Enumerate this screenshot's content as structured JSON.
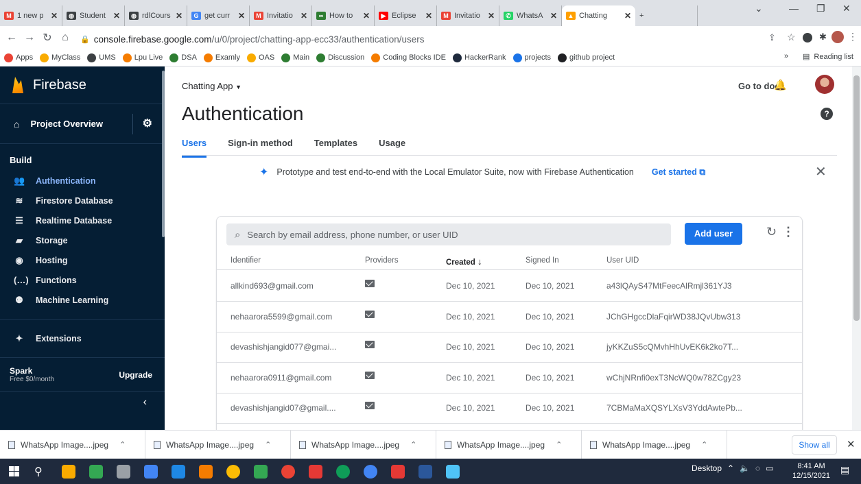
{
  "browser": {
    "tabs": [
      {
        "label": "1 new p",
        "color": "#ea4335",
        "glyph": "M"
      },
      {
        "label": "Student",
        "color": "#3c4043",
        "glyph": "◍"
      },
      {
        "label": "rdlCours",
        "color": "#3c4043",
        "glyph": "◍"
      },
      {
        "label": "get curr",
        "color": "#4285f4",
        "glyph": "G"
      },
      {
        "label": "Invitatio",
        "color": "#ea4335",
        "glyph": "M"
      },
      {
        "label": "How to",
        "color": "#2e7d32",
        "glyph": "∞"
      },
      {
        "label": "Eclipse",
        "color": "#ff0000",
        "glyph": "▶"
      },
      {
        "label": "Invitatio",
        "color": "#ea4335",
        "glyph": "M"
      },
      {
        "label": "WhatsA",
        "color": "#25d366",
        "glyph": "✆"
      },
      {
        "label": "Chatting",
        "color": "#ffa000",
        "glyph": "▲",
        "active": true
      }
    ],
    "url_host": "console.firebase.google.com",
    "url_path": "/u/0/project/chatting-app-ecc33/authentication/users",
    "bookmarks": [
      {
        "label": "Apps",
        "color": "#ea4335"
      },
      {
        "label": "MyClass",
        "color": "#f9ab00"
      },
      {
        "label": "UMS",
        "color": "#3c4043"
      },
      {
        "label": "Lpu Live",
        "color": "#f57c00"
      },
      {
        "label": "DSA",
        "color": "#2e7d32"
      },
      {
        "label": "Examly",
        "color": "#f57c00"
      },
      {
        "label": "OAS",
        "color": "#f9ab00"
      },
      {
        "label": "Main",
        "color": "#2e7d32"
      },
      {
        "label": "Discussion",
        "color": "#2e7d32"
      },
      {
        "label": "Coding Blocks IDE",
        "color": "#f57c00"
      },
      {
        "label": "HackerRank",
        "color": "#1f2a3d"
      },
      {
        "label": "projects",
        "color": "#1a73e8"
      },
      {
        "label": "github project",
        "color": "#202124"
      }
    ],
    "reading_list": "Reading list"
  },
  "sidebar": {
    "brand": "Firebase",
    "project_overview": "Project Overview",
    "build_heading": "Build",
    "items": [
      {
        "label": "Authentication",
        "icon": "people-icon",
        "glyph": "👥",
        "active": true
      },
      {
        "label": "Firestore Database",
        "icon": "firestore-icon",
        "glyph": "≋"
      },
      {
        "label": "Realtime Database",
        "icon": "database-icon",
        "glyph": "☰"
      },
      {
        "label": "Storage",
        "icon": "storage-icon",
        "glyph": "▰"
      },
      {
        "label": "Hosting",
        "icon": "hosting-icon",
        "glyph": "◉"
      },
      {
        "label": "Functions",
        "icon": "functions-icon",
        "glyph": "(…)"
      },
      {
        "label": "Machine Learning",
        "icon": "robot-icon",
        "glyph": "⚉"
      }
    ],
    "extensions": "Extensions",
    "plan_name": "Spark",
    "plan_price": "Free $0/month",
    "upgrade": "Upgrade"
  },
  "header": {
    "project": "Chatting App",
    "go_to_docs": "Go to docs",
    "title": "Authentication",
    "tabs": [
      "Users",
      "Sign-in method",
      "Templates",
      "Usage"
    ]
  },
  "banner": {
    "text": "Prototype and test end-to-end with the Local Emulator Suite, now with Firebase Authentication",
    "link": "Get started"
  },
  "users": {
    "search_placeholder": "Search by email address, phone number, or user UID",
    "add_user": "Add user",
    "columns": [
      "Identifier",
      "Providers",
      "Created",
      "Signed In",
      "User UID"
    ],
    "rows": [
      {
        "identifier": "allkind693@gmail.com",
        "created": "Dec 10, 2021",
        "signed_in": "Dec 10, 2021",
        "uid": "a43lQAyS47MtFeecAlRmjl361YJ3"
      },
      {
        "identifier": "nehaarora5599@gmail.com",
        "created": "Dec 10, 2021",
        "signed_in": "Dec 10, 2021",
        "uid": "JChGHgccDlaFqirWD38JQvUbw313"
      },
      {
        "identifier": "devashishjangid077@gmai...",
        "created": "Dec 10, 2021",
        "signed_in": "Dec 10, 2021",
        "uid": "jyKKZuS5cQMvhHhUvEK6k2ko7T..."
      },
      {
        "identifier": "nehaarora0911@gmail.com",
        "created": "Dec 10, 2021",
        "signed_in": "Dec 10, 2021",
        "uid": "wChjNRnfi0exT3NcWQ0w78ZCgy23"
      },
      {
        "identifier": "devashishjangid07@gmail....",
        "created": "Dec 10, 2021",
        "signed_in": "Dec 10, 2021",
        "uid": "7CBMaMaXQSYLXsV3YddAwtePb..."
      }
    ]
  },
  "downloads": {
    "items": [
      "WhatsApp Image....jpeg",
      "WhatsApp Image....jpeg",
      "WhatsApp Image....jpeg",
      "WhatsApp Image....jpeg",
      "WhatsApp Image....jpeg"
    ],
    "show_all": "Show all"
  },
  "taskbar": {
    "apps": [
      {
        "name": "search-icon",
        "color": "#1f2a3d"
      },
      {
        "name": "file-explorer-icon",
        "color": "#f9ab00"
      },
      {
        "name": "edge-icon",
        "color": "#34a853"
      },
      {
        "name": "app-icon",
        "color": "#9aa0a6"
      },
      {
        "name": "app-icon",
        "color": "#4285f4"
      },
      {
        "name": "vscode-icon",
        "color": "#1e88e5"
      },
      {
        "name": "app-icon",
        "color": "#f57c00"
      },
      {
        "name": "chrome-icon",
        "color": "#fbbc04"
      },
      {
        "name": "app-icon",
        "color": "#34a853"
      },
      {
        "name": "chrome-icon",
        "color": "#ea4335"
      },
      {
        "name": "app-icon",
        "color": "#e53935"
      },
      {
        "name": "chrome-icon",
        "color": "#0f9d58"
      },
      {
        "name": "chrome-icon",
        "color": "#4285f4"
      },
      {
        "name": "app-icon",
        "color": "#e53935"
      },
      {
        "name": "word-icon",
        "color": "#2b579a"
      },
      {
        "name": "app-icon",
        "color": "#4fc3f7"
      }
    ],
    "desktop": "Desktop",
    "time": "8:41 AM",
    "date": "12/15/2021"
  }
}
